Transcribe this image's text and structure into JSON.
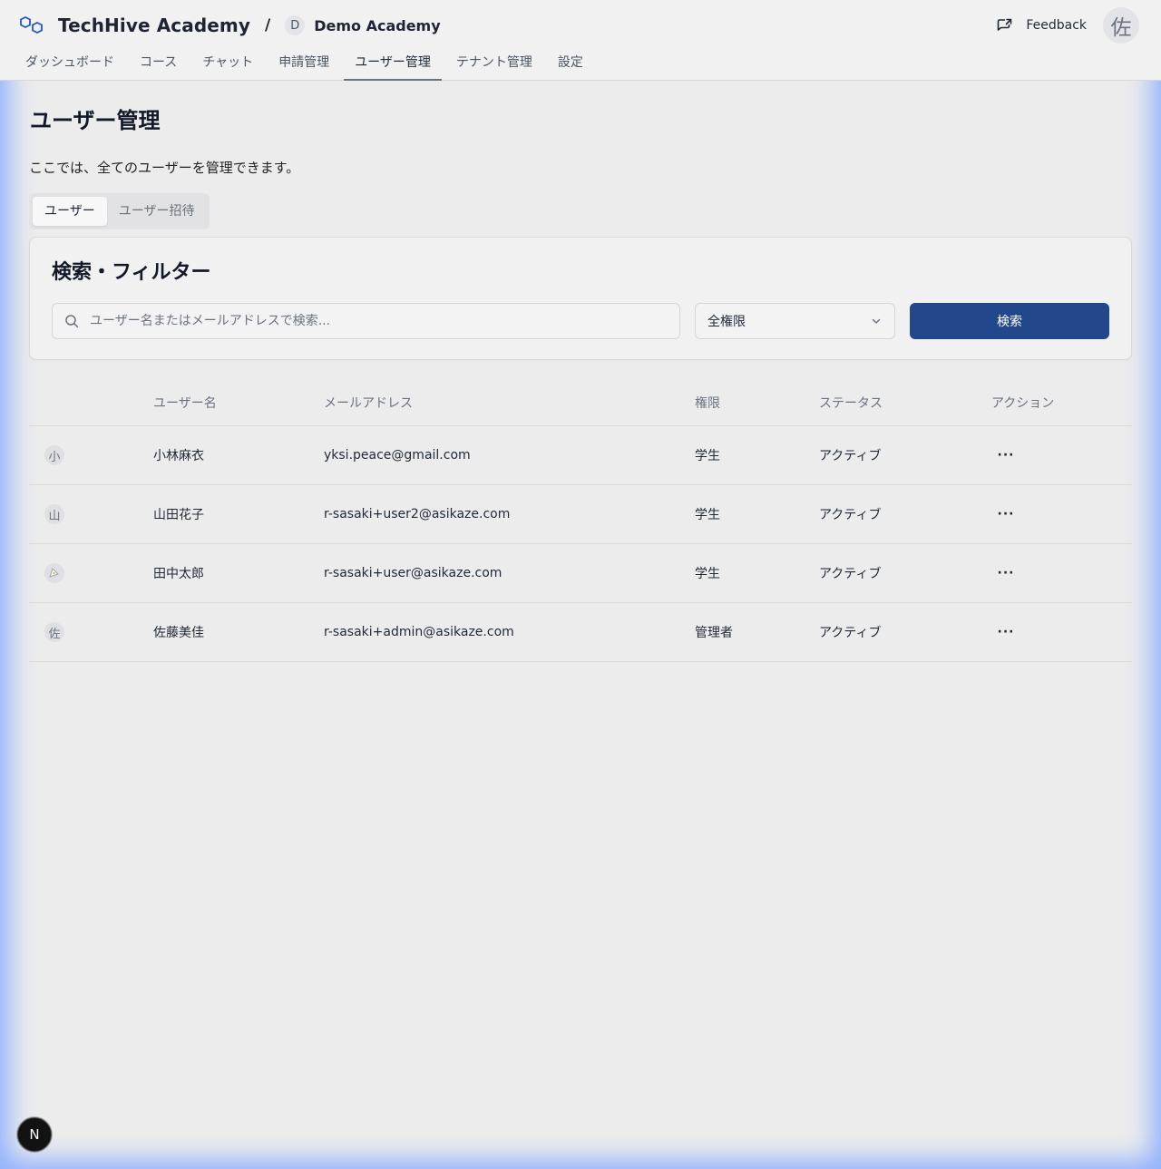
{
  "brand": {
    "name": "TechHive Academy",
    "separator": "/",
    "tenant_initial": "D",
    "tenant_name": "Demo Academy"
  },
  "header": {
    "feedback_label": "Feedback",
    "user_avatar": "佐"
  },
  "nav": {
    "items": [
      {
        "label": "ダッシュボード"
      },
      {
        "label": "コース"
      },
      {
        "label": "チャット"
      },
      {
        "label": "申請管理"
      },
      {
        "label": "ユーザー管理"
      },
      {
        "label": "テナント管理"
      },
      {
        "label": "設定"
      }
    ],
    "active": "ユーザー管理"
  },
  "page": {
    "title": "ユーザー管理",
    "description": "ここでは、全てのユーザーを管理できます。"
  },
  "tabs": [
    {
      "label": "ユーザー"
    },
    {
      "label": "ユーザー招待"
    }
  ],
  "filter": {
    "title": "検索・フィルター",
    "search_placeholder": "ユーザー名またはメールアドレスで検索...",
    "role_select_value": "全権限",
    "search_button": "検索"
  },
  "table": {
    "headers": [
      "",
      "ユーザー名",
      "メールアドレス",
      "権限",
      "ステータス",
      "アクション"
    ],
    "rows": [
      {
        "avatar": "小",
        "name": "小林麻衣",
        "email": "yksi.peace@gmail.com",
        "role": "学生",
        "status": "アクティブ",
        "action": "···"
      },
      {
        "avatar": "山",
        "name": "山田花子",
        "email": "r-sasaki+user2@asikaze.com",
        "role": "学生",
        "status": "アクティブ",
        "action": "···"
      },
      {
        "avatar": "",
        "name": "田中太郎",
        "email": "r-sasaki+user@asikaze.com",
        "role": "学生",
        "status": "アクティブ",
        "action": "···"
      },
      {
        "avatar": "佐",
        "name": "佐藤美佳",
        "email": "r-sasaki+admin@asikaze.com",
        "role": "管理者",
        "status": "アクティブ",
        "action": "···"
      }
    ]
  },
  "dev_badge": "N",
  "colors": {
    "accent": "#22478b",
    "status_active": "#22a34a",
    "background": "#ececec"
  }
}
